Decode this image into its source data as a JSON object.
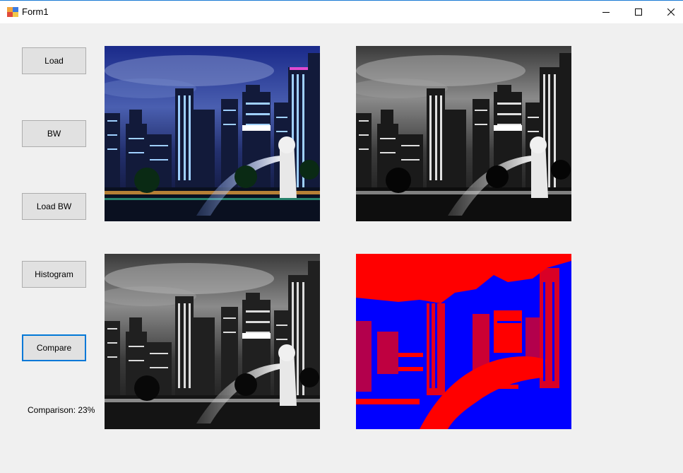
{
  "window": {
    "title": "Form1"
  },
  "buttons": {
    "load": "Load",
    "bw": "BW",
    "load_bw": "Load BW",
    "histogram": "Histogram",
    "compare": "Compare"
  },
  "comparison_label": "Comparison: 23%",
  "colors": {
    "accent": "#0078d7",
    "diff_match": "#ff0000",
    "diff_mismatch": "#0000ff"
  },
  "icons": {
    "app": "form-app-icon",
    "minimize": "minimize-icon",
    "maximize": "maximize-icon",
    "close": "close-icon"
  }
}
